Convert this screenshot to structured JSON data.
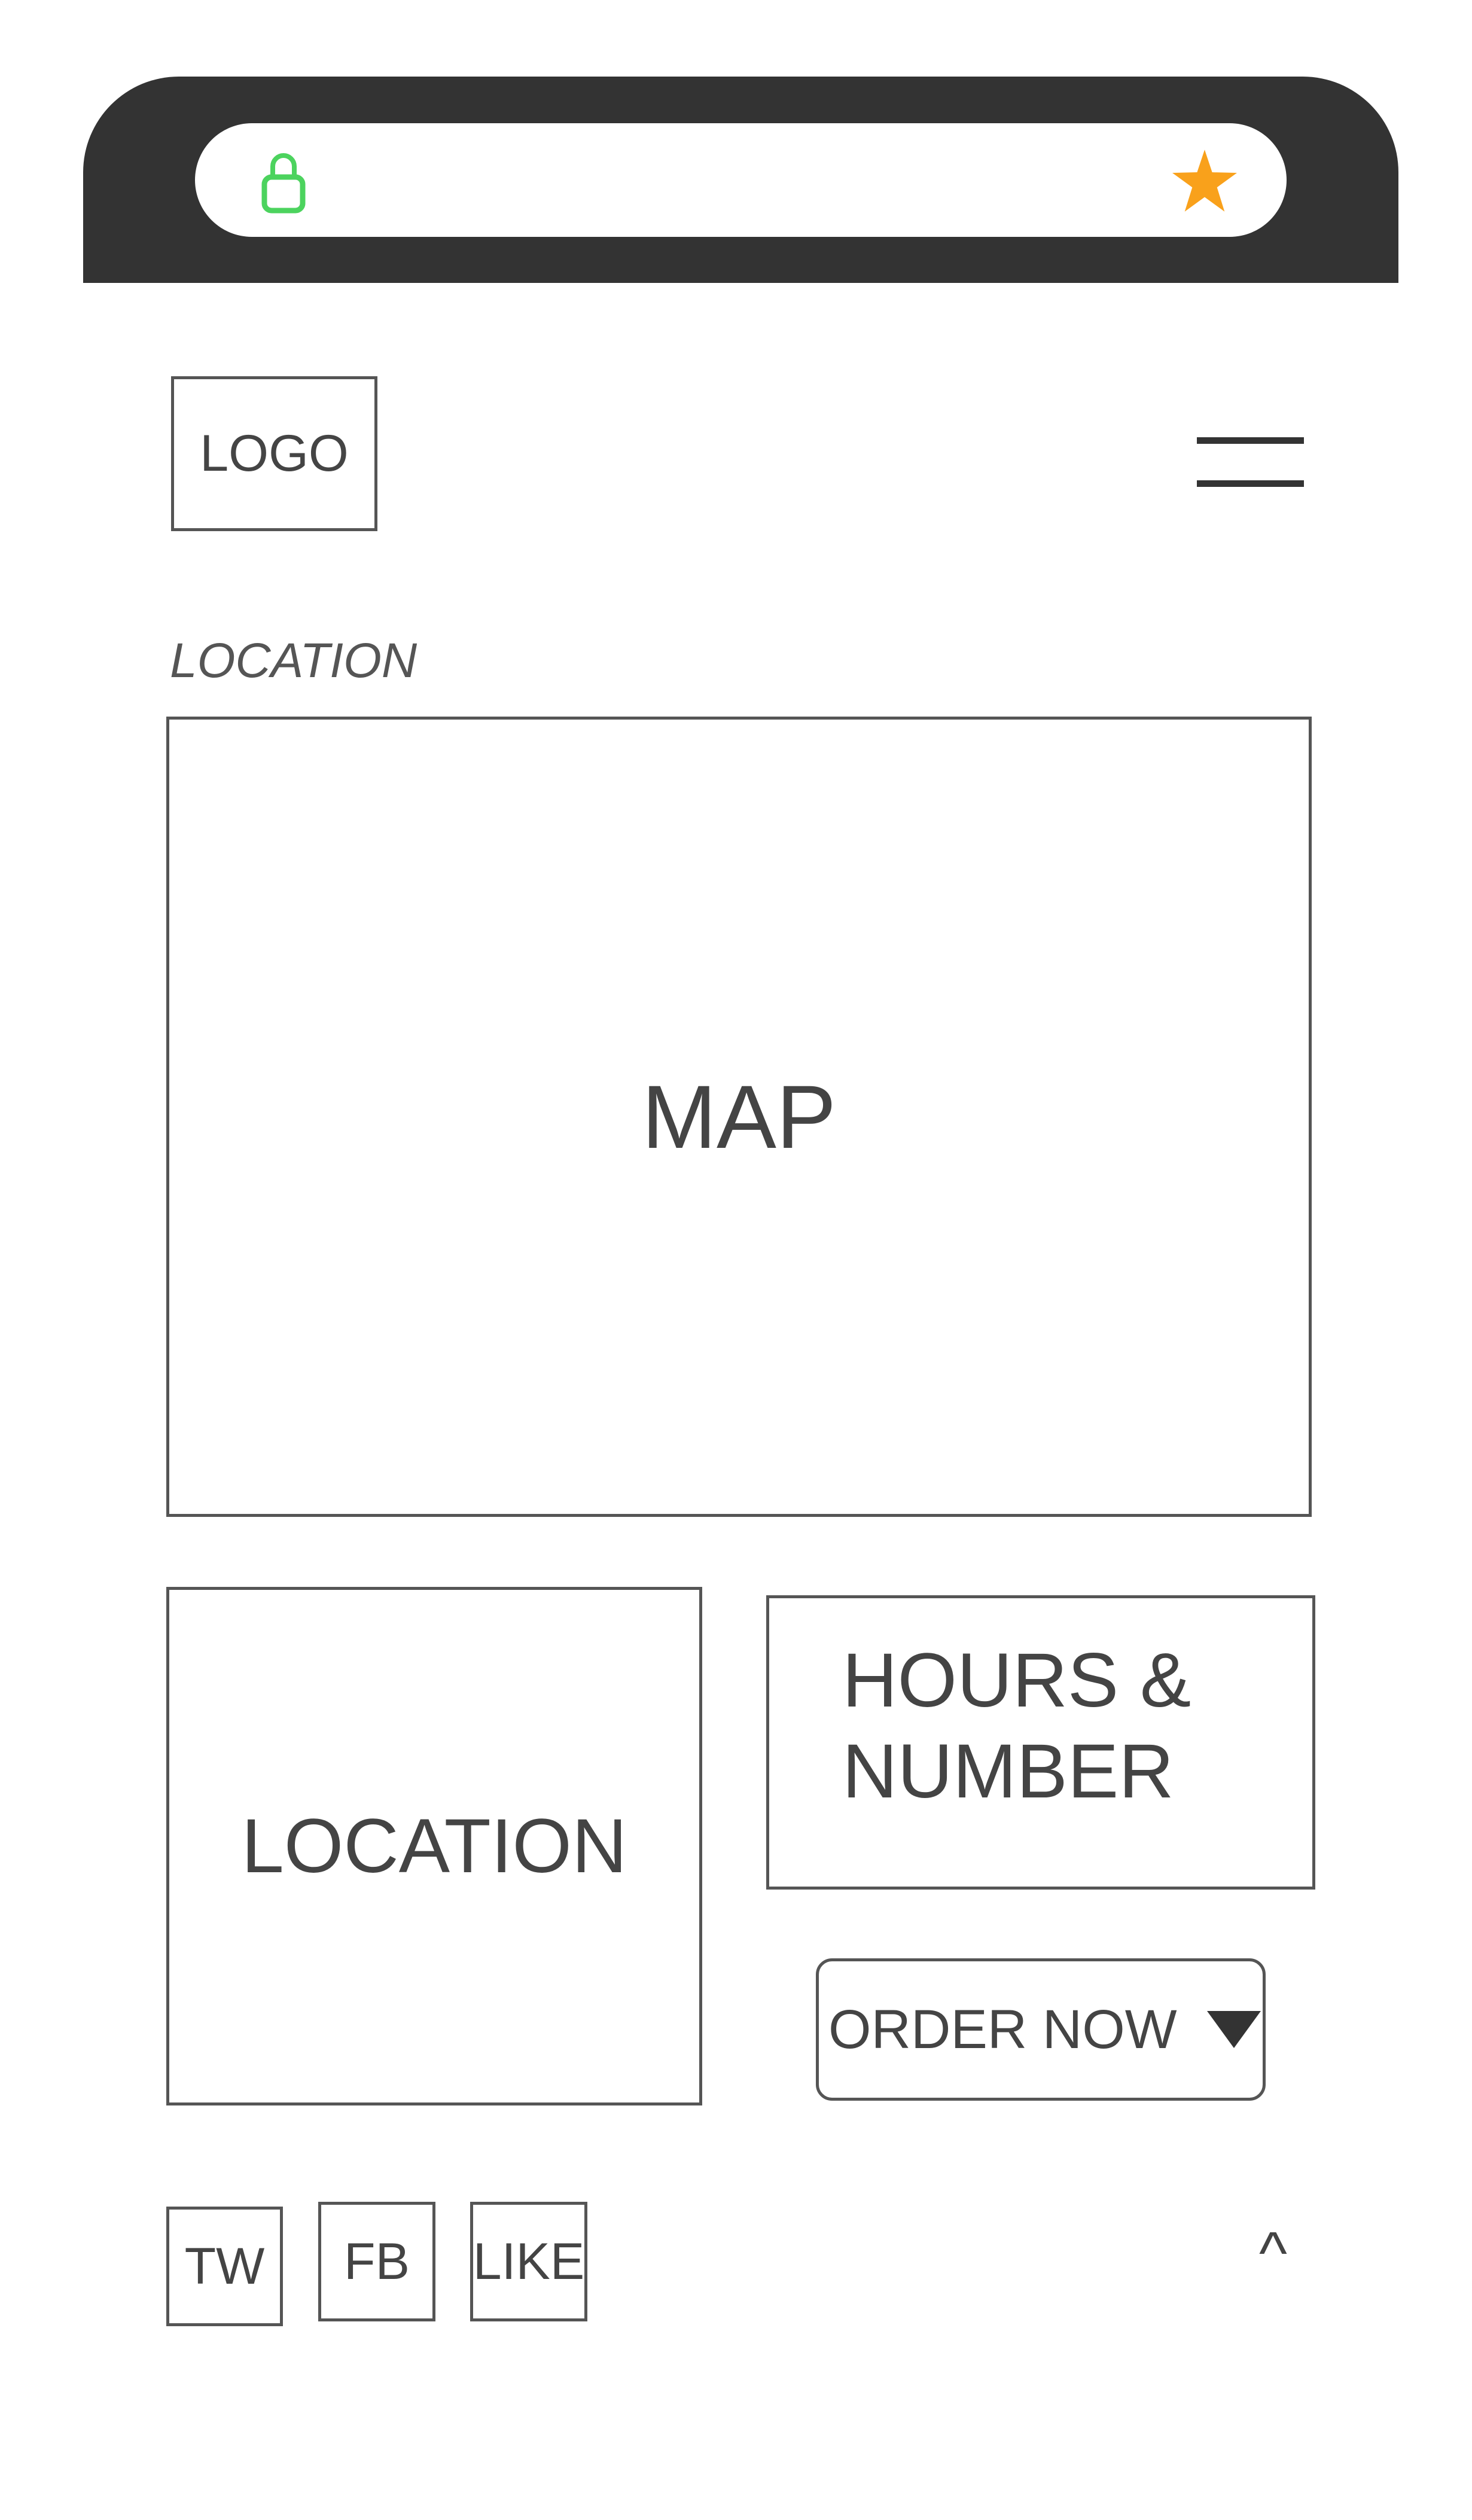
{
  "browser": {
    "lock_icon": "lock-icon",
    "star_icon": "star-icon",
    "lock_color": "#4CD35E",
    "star_color": "#F9A11B",
    "chrome_color": "#333333"
  },
  "header": {
    "logo": "LOGO",
    "menu_icon": "hamburger-icon"
  },
  "section_label": "LOCATION",
  "map": {
    "label": "MAP"
  },
  "location_box": {
    "label": "LOCATION"
  },
  "hours_box": {
    "line1": "HOURS &",
    "line2": "NUMBER"
  },
  "order_button": {
    "label": "ORDER NOW",
    "icon": "caret-down-icon"
  },
  "social": {
    "tw": "TW",
    "fb": "FB",
    "like": "LIKE"
  },
  "back_to_top": "^"
}
